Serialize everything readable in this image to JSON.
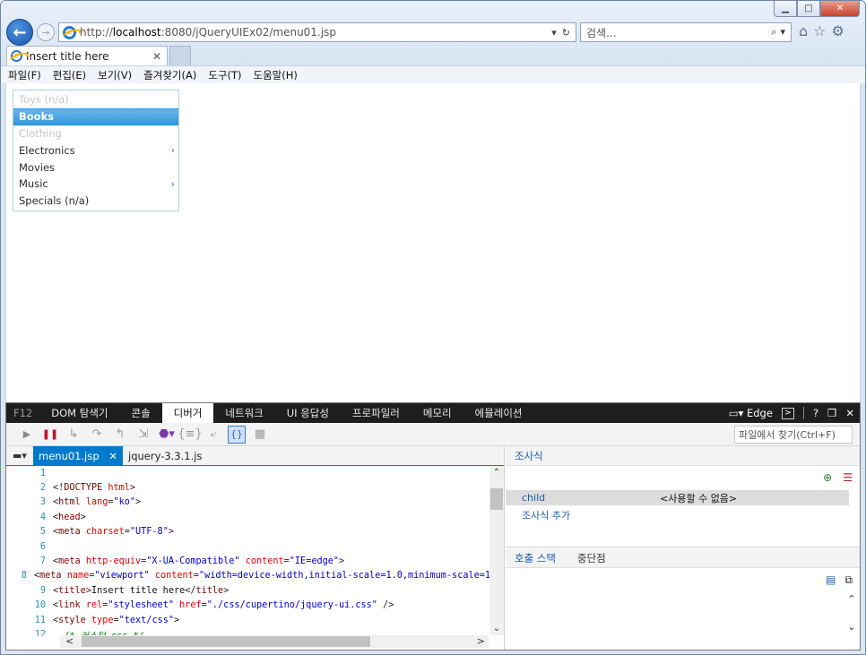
{
  "browser": {
    "url_prefix": "http://",
    "url_host": "localhost",
    "url_rest": ":8080/jQueryUIEx02/menu01.jsp",
    "search_placeholder": "검색...",
    "tab_title": "Insert title here",
    "icons": [
      "back-arrow-icon",
      "forward-arrow-icon",
      "ie-logo-icon",
      "refresh-icon",
      "search-icon",
      "home-icon",
      "star-icon",
      "gear-icon"
    ]
  },
  "menubar": [
    "파일(F)",
    "편집(E)",
    "보기(V)",
    "즐겨찾기(A)",
    "도구(T)",
    "도움말(H)"
  ],
  "page_menu": {
    "items": [
      {
        "label": "Toys (n/a)",
        "state": "disabled",
        "submenu": false
      },
      {
        "label": "Books",
        "state": "active",
        "submenu": false
      },
      {
        "label": "Clothing",
        "state": "disabled",
        "submenu": false
      },
      {
        "label": "Electronics",
        "state": "normal",
        "submenu": true
      },
      {
        "label": "Movies",
        "state": "normal",
        "submenu": false
      },
      {
        "label": "Music",
        "state": "normal",
        "submenu": true
      },
      {
        "label": "Specials (n/a)",
        "state": "normal",
        "submenu": false
      }
    ],
    "accent_color": "#3398dd"
  },
  "devtools": {
    "tabs": [
      "F12",
      "DOM 탐색기",
      "콘솔",
      "디버거",
      "네트워크",
      "UI 응답성",
      "프로파일러",
      "메모리",
      "에뮬레이션"
    ],
    "active_tab": "디버거",
    "mode": "Edge",
    "help": "?",
    "find_placeholder": "파일에서 찾기(Ctrl+F)",
    "file_tabs": [
      "menu01.jsp",
      "jquery-3.3.1.js"
    ],
    "active_file": "menu01.jsp",
    "code_lines": [
      {
        "n": "1",
        "parts": []
      },
      {
        "n": "2",
        "parts": [
          [
            "c-punct",
            "<!"
          ],
          [
            "c-tag",
            "DOCTYPE "
          ],
          [
            "c-attr",
            "html"
          ],
          [
            "c-punct",
            ">"
          ]
        ]
      },
      {
        "n": "3",
        "parts": [
          [
            "c-punct",
            "<"
          ],
          [
            "c-tag",
            "html "
          ],
          [
            "c-attr",
            "lang"
          ],
          [
            "c-punct",
            "="
          ],
          [
            "c-val",
            "\"ko\""
          ],
          [
            "c-punct",
            ">"
          ]
        ]
      },
      {
        "n": "4",
        "parts": [
          [
            "c-punct",
            "<"
          ],
          [
            "c-tag",
            "head"
          ],
          [
            "c-punct",
            ">"
          ]
        ]
      },
      {
        "n": "5",
        "parts": [
          [
            "c-punct",
            "<"
          ],
          [
            "c-tag",
            "meta "
          ],
          [
            "c-attr",
            "charset"
          ],
          [
            "c-punct",
            "="
          ],
          [
            "c-val",
            "\"UTF-8\""
          ],
          [
            "c-punct",
            ">"
          ]
        ]
      },
      {
        "n": "6",
        "parts": []
      },
      {
        "n": "7",
        "parts": [
          [
            "c-punct",
            "<"
          ],
          [
            "c-tag",
            "meta "
          ],
          [
            "c-attr",
            "http-equiv"
          ],
          [
            "c-punct",
            "="
          ],
          [
            "c-val",
            "\"X-UA-Compatible\" "
          ],
          [
            "c-attr",
            "content"
          ],
          [
            "c-punct",
            "="
          ],
          [
            "c-val",
            "\"IE=edge\""
          ],
          [
            "c-punct",
            ">"
          ]
        ]
      },
      {
        "n": "8",
        "parts": [
          [
            "c-punct",
            "<"
          ],
          [
            "c-tag",
            "meta "
          ],
          [
            "c-attr",
            "name"
          ],
          [
            "c-punct",
            "="
          ],
          [
            "c-val",
            "\"viewport\" "
          ],
          [
            "c-attr",
            "content"
          ],
          [
            "c-punct",
            "="
          ],
          [
            "c-val",
            "\"width=device-width,initial-scale=1.0,minimum-scale=1"
          ]
        ]
      },
      {
        "n": "9",
        "parts": [
          [
            "c-punct",
            "<"
          ],
          [
            "c-tag",
            "title"
          ],
          [
            "c-punct",
            ">"
          ],
          [
            "c-text",
            "Insert title here"
          ],
          [
            "c-punct",
            "</"
          ],
          [
            "c-tag",
            "title"
          ],
          [
            "c-punct",
            ">"
          ]
        ]
      },
      {
        "n": "10",
        "parts": [
          [
            "c-punct",
            "<"
          ],
          [
            "c-tag",
            "link "
          ],
          [
            "c-attr",
            "rel"
          ],
          [
            "c-punct",
            "="
          ],
          [
            "c-val",
            "\"stylesheet\" "
          ],
          [
            "c-attr",
            "href"
          ],
          [
            "c-punct",
            "="
          ],
          [
            "c-val",
            "\"./css/cupertino/jquery-ui.css\" "
          ],
          [
            "c-punct",
            "/>"
          ]
        ]
      },
      {
        "n": "11",
        "parts": [
          [
            "c-punct",
            "<"
          ],
          [
            "c-tag",
            "style "
          ],
          [
            "c-attr",
            "type"
          ],
          [
            "c-punct",
            "="
          ],
          [
            "c-val",
            "\"text/css\""
          ],
          [
            "c-punct",
            ">"
          ]
        ]
      },
      {
        "n": "12",
        "parts": [
          [
            "c-comment",
            "  /* 커스텀 css */"
          ]
        ]
      }
    ],
    "watch_title": "조사식",
    "watch_rows": [
      {
        "name": "child",
        "value": "<사용할 수 없음>"
      }
    ],
    "add_watch": "조사식 추가",
    "stack_tabs": [
      "호출 스택",
      "중단점"
    ]
  }
}
